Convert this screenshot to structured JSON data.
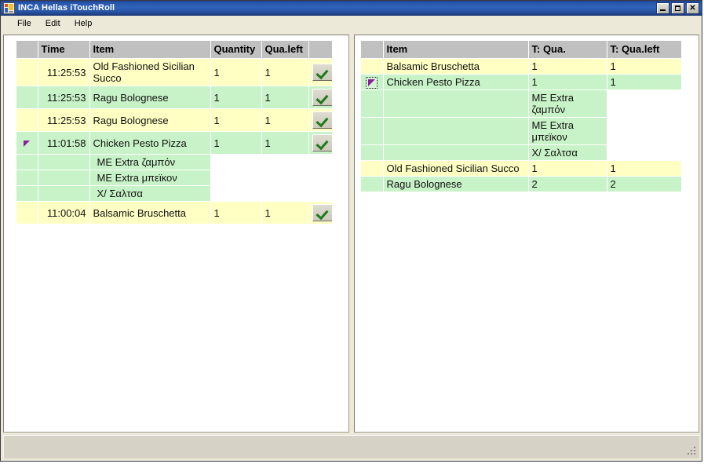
{
  "window": {
    "title": "INCA Hellas iTouchRoll",
    "icon": "application-icon",
    "buttons": {
      "minimize": "minimize",
      "maximize": "maximize",
      "close": "close"
    }
  },
  "menu": {
    "items": [
      {
        "label": "File"
      },
      {
        "label": "Edit"
      },
      {
        "label": "Help"
      }
    ]
  },
  "left_grid": {
    "columns": [
      "",
      "Time",
      "Item",
      "Quantity",
      "Qua.left",
      ""
    ],
    "rows": [
      {
        "marker": "",
        "time": "11:25:53",
        "item": "Old Fashioned Sicilian Succo",
        "quantity": "1",
        "qua_left": "1",
        "action": "confirm-check",
        "color": "yellow",
        "type": "order"
      },
      {
        "marker": "",
        "time": "11:25:53",
        "item": "Ragu Bolognese",
        "quantity": "1",
        "qua_left": "1",
        "action": "confirm-check",
        "color": "green",
        "type": "order"
      },
      {
        "marker": "",
        "time": "11:25:53",
        "item": "Ragu Bolognese",
        "quantity": "1",
        "qua_left": "1",
        "action": "confirm-check",
        "color": "yellow",
        "type": "order"
      },
      {
        "marker": "expander-triangle",
        "time": "11:01:58",
        "item": "Chicken Pesto Pizza",
        "quantity": "1",
        "qua_left": "1",
        "action": "confirm-check",
        "color": "green",
        "type": "order"
      },
      {
        "marker": "",
        "time": "",
        "item": "ME Extra ζαμπόν",
        "quantity": "",
        "qua_left": "",
        "action": "",
        "color": "green",
        "type": "modifier"
      },
      {
        "marker": "",
        "time": "",
        "item": "ME Extra μπεϊκον",
        "quantity": "",
        "qua_left": "",
        "action": "",
        "color": "green",
        "type": "modifier"
      },
      {
        "marker": "",
        "time": "",
        "item": "Χ/ Σαλτσα",
        "quantity": "",
        "qua_left": "",
        "action": "",
        "color": "green",
        "type": "modifier"
      },
      {
        "marker": "",
        "time": "11:00:04",
        "item": "Balsamic Bruschetta",
        "quantity": "1",
        "qua_left": "1",
        "action": "confirm-check",
        "color": "yellow",
        "type": "order"
      }
    ]
  },
  "right_grid": {
    "columns": [
      "",
      "Item",
      "T: Qua.",
      "T: Qua.left"
    ],
    "rows": [
      {
        "marker": "",
        "item": "Balsamic Bruschetta",
        "t_qua": "1",
        "t_qua_left": "1",
        "color": "yellow",
        "type": "item"
      },
      {
        "marker": "expander-triangle-selected",
        "item": "Chicken Pesto Pizza",
        "t_qua": "1",
        "t_qua_left": "1",
        "color": "green",
        "type": "item"
      },
      {
        "marker": "",
        "item": "",
        "t_qua": "ME Extra ζαμπόν",
        "t_qua_left": "",
        "color": "green",
        "type": "modifier"
      },
      {
        "marker": "",
        "item": "",
        "t_qua": "ME Extra μπεϊκον",
        "t_qua_left": "",
        "color": "green",
        "type": "modifier"
      },
      {
        "marker": "",
        "item": "",
        "t_qua": "Χ/ Σαλτσα",
        "t_qua_left": "",
        "color": "green",
        "type": "modifier"
      },
      {
        "marker": "",
        "item": "Old Fashioned Sicilian Succo",
        "t_qua": "1",
        "t_qua_left": "1",
        "color": "yellow",
        "type": "item"
      },
      {
        "marker": "",
        "item": "Ragu Bolognese",
        "t_qua": "2",
        "t_qua_left": "2",
        "color": "green",
        "type": "item"
      }
    ]
  },
  "statusbar": {
    "text": ""
  },
  "colors": {
    "title_start": "#1c3f8e",
    "title_end": "#1b3576",
    "row_yellow": "#ffffc4",
    "row_green": "#c8f2c8",
    "header_gray": "#c0c0c0",
    "chrome": "#ece9d8",
    "check_green": "#1d7a1d",
    "expander_purple": "#8a1f9b"
  }
}
